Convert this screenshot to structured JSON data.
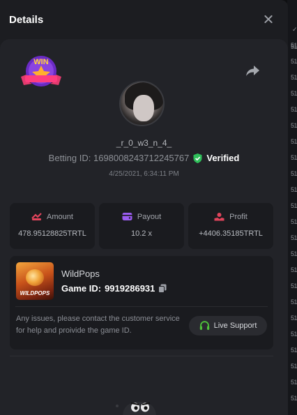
{
  "modal": {
    "title": "Details"
  },
  "player": {
    "username": "_r_0_w3_n_4_",
    "betting_id": "Betting ID: 1698008243712245767",
    "verified_label": "Verified",
    "datetime": "4/25/2021, 6:34:11 PM",
    "badge_text": "WIN"
  },
  "stats": [
    {
      "label": "Amount",
      "value": "478.95128825TRTL",
      "icon": "amount-icon"
    },
    {
      "label": "Payout",
      "value": "10.2 x",
      "icon": "wallet-icon"
    },
    {
      "label": "Profit",
      "value": "+4406.35185TRTL",
      "icon": "profit-icon"
    }
  ],
  "game": {
    "name": "WildPops",
    "id_prefix": "Game ID:",
    "id_value": "9919286931",
    "thumb_text": "WILDPOPS"
  },
  "support": {
    "text": "Any issues, please contact the customer service for help and proivide the game ID.",
    "button_label": "Live Support"
  },
  "background_rows": [
    "51",
    "✓",
    "51",
    "51",
    "51",
    "51",
    "51",
    "51",
    "51",
    "51",
    "51",
    "51",
    "51",
    "51",
    "51",
    "51",
    "51",
    "51",
    "51",
    "51",
    "51",
    "51",
    "51",
    "51",
    "51"
  ],
  "colors": {
    "verified_green": "#2fbf5a",
    "amount_red": "#e0445b",
    "payout_purple": "#9b5cf0",
    "profit_red": "#e0445b",
    "support_green": "#4fc23a"
  }
}
